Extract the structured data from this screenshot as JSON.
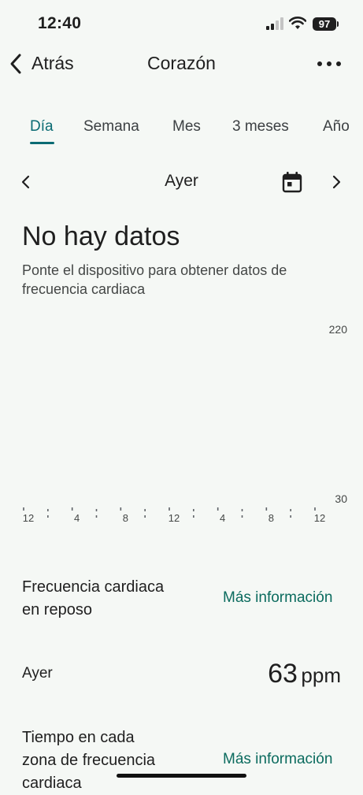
{
  "status_bar": {
    "time": "12:40",
    "battery": "97"
  },
  "header": {
    "back_label": "Atrás",
    "title": "Corazón"
  },
  "tabs": [
    {
      "label": "Día",
      "active": true
    },
    {
      "label": "Semana",
      "active": false
    },
    {
      "label": "Mes",
      "active": false
    },
    {
      "label": "3 meses",
      "active": false
    },
    {
      "label": "Año",
      "active": false
    }
  ],
  "date_nav": {
    "label": "Ayer"
  },
  "no_data": {
    "title": "No hay datos",
    "subtitle": "Ponte el dispositivo para obtener datos de frecuencia cardiaca"
  },
  "chart_data": {
    "type": "line",
    "series": [],
    "x_tick_labels": [
      "12",
      "4",
      "8",
      "12",
      "4",
      "8",
      "12"
    ],
    "ylim": [
      30,
      220
    ],
    "y_tick_labels": [
      "220",
      "30"
    ]
  },
  "resting_hr": {
    "title_line1": "Frecuencia cardiaca",
    "title_line2": "en reposo",
    "link": "Más información",
    "row_label": "Ayer",
    "value": "63",
    "unit": "ppm"
  },
  "zones": {
    "title_line1": "Tiempo en cada",
    "title_line2": "zona de frecuencia",
    "title_line3": "cardiaca",
    "link": "Más información"
  },
  "colors": {
    "accent": "#0b6b73",
    "link": "#0b6b5e",
    "background": "#f5f8f5"
  }
}
